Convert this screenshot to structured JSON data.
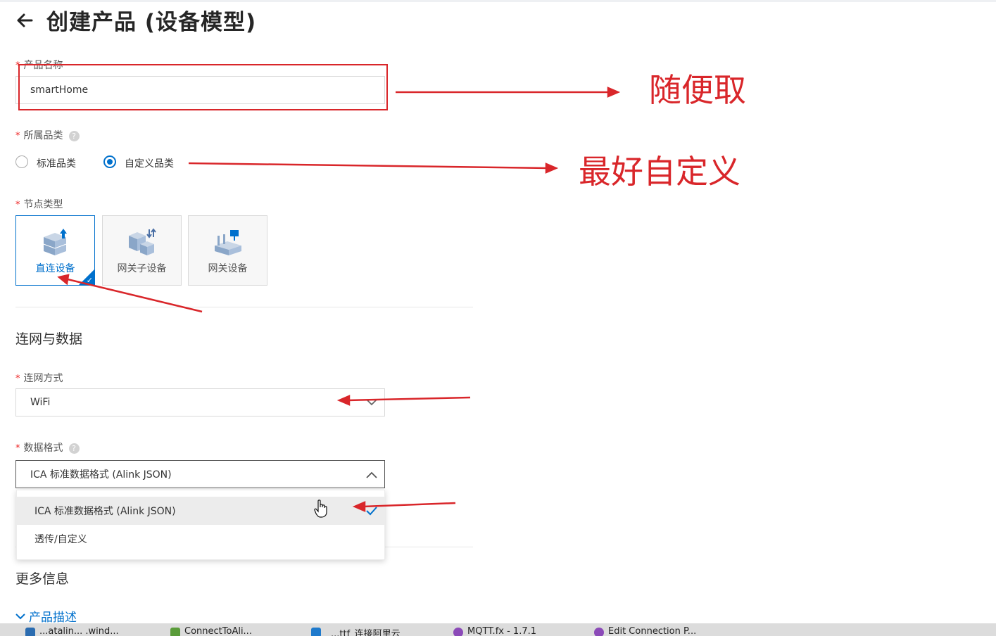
{
  "header": {
    "back_icon": "arrow-left-icon",
    "title": "创建产品 (设备模型)"
  },
  "product_name": {
    "label": "产品名称",
    "required_mark": "*",
    "value": "smartHome"
  },
  "category": {
    "label": "所属品类",
    "required_mark": "*",
    "help": "?",
    "options": [
      {
        "label": "标准品类",
        "selected": false
      },
      {
        "label": "自定义品类",
        "selected": true
      }
    ]
  },
  "node_type": {
    "label": "节点类型",
    "required_mark": "*",
    "cards": [
      {
        "label": "直连设备",
        "icon": "direct-device-icon",
        "selected": true
      },
      {
        "label": "网关子设备",
        "icon": "gateway-subdevice-icon",
        "selected": false
      },
      {
        "label": "网关设备",
        "icon": "gateway-device-icon",
        "selected": false
      }
    ],
    "check_glyph": "✓"
  },
  "network_section": {
    "title": "连网与数据",
    "connection": {
      "label": "连网方式",
      "required_mark": "*",
      "value": "WiFi"
    },
    "data_format": {
      "label": "数据格式",
      "required_mark": "*",
      "help": "?",
      "value": "ICA 标准数据格式 (Alink JSON)",
      "options": [
        {
          "label": "ICA 标准数据格式 (Alink JSON)",
          "selected": true
        },
        {
          "label": "透传/自定义",
          "selected": false
        }
      ]
    }
  },
  "more_section": {
    "title": "更多信息",
    "description_toggle": "产品描述"
  },
  "annotations": {
    "note1": "随便取",
    "note2": "最好自定义",
    "color": "#d9262a"
  },
  "colors": {
    "accent": "#0070cc",
    "required": "#e22222"
  },
  "taskbar": {
    "items": [
      {
        "label": "...atalin... .wind...",
        "icon": "window-app-icon"
      },
      {
        "label": "ConnectToAli...",
        "icon": "code-file-icon"
      },
      {
        "label": "...ttf_连接阿里云",
        "icon": "vscode-icon"
      },
      {
        "label": "MQTT.fx - 1.7.1",
        "icon": "mqttfx-icon"
      },
      {
        "label": "Edit Connection P...",
        "icon": "mqttfx-icon"
      }
    ]
  }
}
